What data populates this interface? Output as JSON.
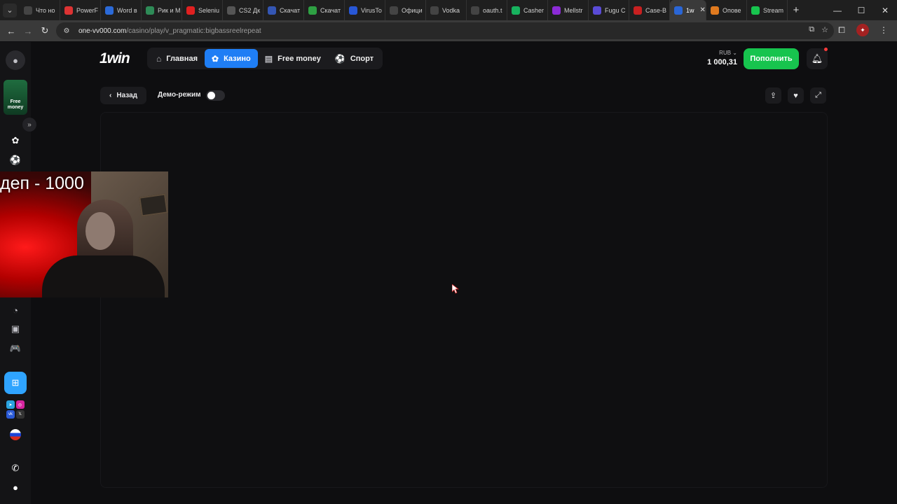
{
  "browser": {
    "tabs": [
      {
        "label": "Что но",
        "color": "#444"
      },
      {
        "label": "PowerF",
        "color": "#d33"
      },
      {
        "label": "Word в",
        "color": "#2b6ad8"
      },
      {
        "label": "Рик и М",
        "color": "#2e8b57"
      },
      {
        "label": "Seleniu",
        "color": "#e02020"
      },
      {
        "label": "CS2 Дк",
        "color": "#555"
      },
      {
        "label": "Скачат",
        "color": "#3456b3"
      },
      {
        "label": "Скачат",
        "color": "#2ea043"
      },
      {
        "label": "VirusTo",
        "color": "#2857d6"
      },
      {
        "label": "Офици",
        "color": "#444"
      },
      {
        "label": "Vodka",
        "color": "#444"
      },
      {
        "label": "oauth.t",
        "color": "#444"
      },
      {
        "label": "Casher",
        "color": "#17b25e"
      },
      {
        "label": "Mellstr",
        "color": "#8b2bd6"
      },
      {
        "label": "Fugu C",
        "color": "#5a4bd6"
      },
      {
        "label": "Case-B",
        "color": "#c82020"
      },
      {
        "label": "1w",
        "color": "#2a66d6",
        "active": true
      },
      {
        "label": "Опове",
        "color": "#e07a1f"
      },
      {
        "label": "Stream",
        "color": "#17c44e"
      }
    ],
    "url_host": "one-vv000.com",
    "url_path": "/casino/play/v_pragmatic:bigbassreelrepeat"
  },
  "site": {
    "logo": "1win",
    "nav": [
      {
        "label": "Главная",
        "icon": "home-icon"
      },
      {
        "label": "Казино",
        "icon": "casino-chip-icon",
        "active": true
      },
      {
        "label": "Free money",
        "icon": "money-icon"
      },
      {
        "label": "Спорт",
        "icon": "ball-icon"
      }
    ],
    "currency": "RUB",
    "balance": "1 000,31",
    "deposit_label": "Пополнить"
  },
  "game_bar": {
    "back_label": "Назад",
    "demo_label": "Демо-режим",
    "demo_enabled": false
  },
  "rail": {
    "free_money_label_1": "Free",
    "free_money_label_2": "money"
  },
  "webcam": {
    "caption": "деп - 1000"
  },
  "colors": {
    "accent_blue": "#1f7ef5",
    "deposit_green": "#17c44e",
    "background": "#0e0e10"
  }
}
